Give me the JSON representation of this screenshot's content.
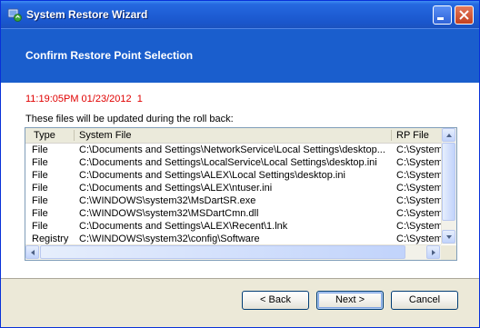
{
  "window": {
    "title": "System Restore Wizard"
  },
  "header": {
    "title": "Confirm Restore Point Selection"
  },
  "restore_point": {
    "timestamp": "11:19:05PM 01/23/2012",
    "number": "1"
  },
  "instructions": "These files will be updated during the roll back:",
  "list": {
    "columns": [
      "Type",
      "System File",
      "RP File"
    ],
    "rows": [
      [
        "File",
        "C:\\Documents and Settings\\NetworkService\\Local Settings\\desktop...",
        "C:\\System"
      ],
      [
        "File",
        "C:\\Documents and Settings\\LocalService\\Local Settings\\desktop.ini",
        "C:\\System"
      ],
      [
        "File",
        "C:\\Documents and Settings\\ALEX\\Local Settings\\desktop.ini",
        "C:\\System"
      ],
      [
        "File",
        "C:\\Documents and Settings\\ALEX\\ntuser.ini",
        "C:\\System"
      ],
      [
        "File",
        "C:\\WINDOWS\\system32\\MsDartSR.exe",
        "C:\\System"
      ],
      [
        "File",
        "C:\\WINDOWS\\system32\\MSDartCmn.dll",
        "C:\\System"
      ],
      [
        "File",
        "C:\\Documents and Settings\\ALEX\\Recent\\1.lnk",
        "C:\\System"
      ],
      [
        "Registry",
        "C:\\WINDOWS\\system32\\config\\Software",
        "C:\\System"
      ]
    ]
  },
  "buttons": {
    "back": "< Back",
    "next": "Next >",
    "cancel": "Cancel"
  },
  "colors": {
    "title_bar": "#1f5fd6",
    "header_band": "#1a5ecd",
    "timestamp": "#e00000",
    "window_face": "#ece9d8"
  },
  "icons": [
    "system-restore-icon",
    "minimize-icon",
    "close-icon",
    "scroll-up-icon",
    "scroll-down-icon",
    "scroll-left-icon",
    "scroll-right-icon"
  ]
}
